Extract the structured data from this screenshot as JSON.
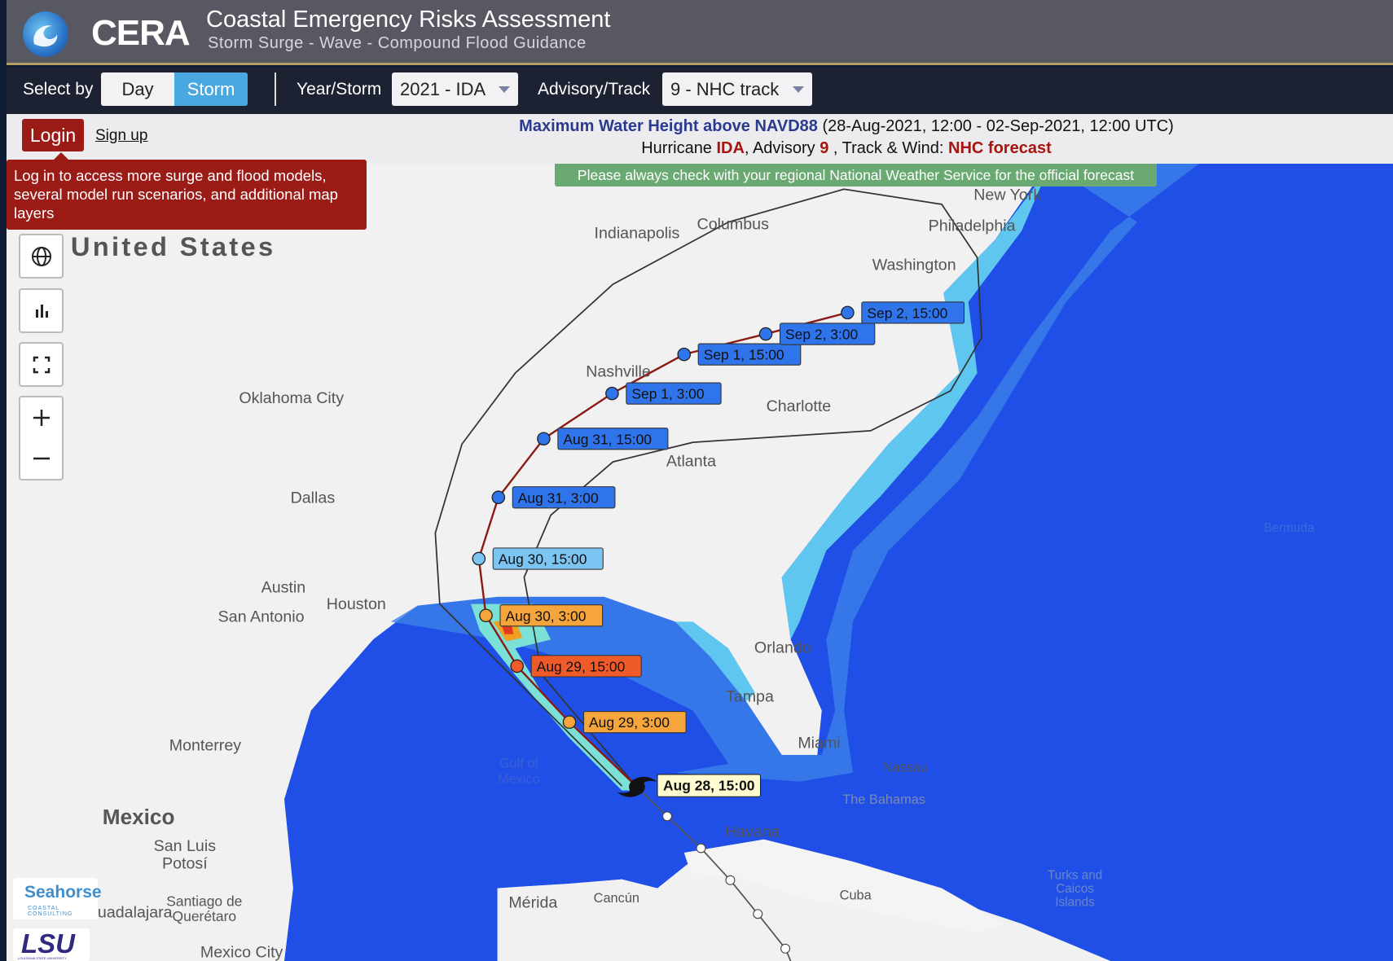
{
  "header": {
    "brand": "CERA",
    "title": "Coastal Emergency Risks Assessment",
    "subtitle": "Storm Surge - Wave - Compound Flood Guidance"
  },
  "toolbar": {
    "select_by_label": "Select by",
    "day": "Day",
    "storm": "Storm",
    "active": "Storm",
    "year_storm_label": "Year/Storm",
    "year_storm_value": "2021 - IDA",
    "advisory_label": "Advisory/Track",
    "advisory_value": "9 - NHC track"
  },
  "auth": {
    "login": "Login",
    "signup": "Sign up",
    "tooltip": "Log in to access more surge and flood models, several model run scenarios, and additional map layers"
  },
  "info": {
    "product": "Maximum Water Height above NAVD88",
    "period": " (28-Aug-2021, 12:00 - 02-Sep-2021, 12:00 UTC)",
    "hurricane_label": "Hurricane ",
    "storm": "IDA",
    "advisory_label": ", Advisory ",
    "advisory": "9",
    "track_label": " , Track & Wind: ",
    "track": "NHC forecast"
  },
  "notice": "Please always check with your regional National Weather Service for the official forecast",
  "track": {
    "current": "Aug 28, 15:00",
    "points": [
      {
        "label": "Aug 29, 3:00",
        "color": "#f6a53c"
      },
      {
        "label": "Aug 29, 15:00",
        "color": "#ef5a2b"
      },
      {
        "label": "Aug 30, 3:00",
        "color": "#f6a53c"
      },
      {
        "label": "Aug 30, 15:00",
        "color": "#7cc4f2"
      },
      {
        "label": "Aug 31, 3:00",
        "color": "#2f74ea"
      },
      {
        "label": "Aug 31, 15:00",
        "color": "#2f74ea"
      },
      {
        "label": "Sep 1, 3:00",
        "color": "#2f74ea"
      },
      {
        "label": "Sep 1, 15:00",
        "color": "#2f74ea"
      },
      {
        "label": "Sep 2, 3:00",
        "color": "#2f74ea"
      },
      {
        "label": "Sep 2, 15:00",
        "color": "#2f74ea"
      }
    ],
    "track_color": "#8b1a14"
  },
  "map_labels": {
    "us": "United States",
    "indianapolis": "Indianapolis",
    "columbus": "Columbus",
    "new_york": "New York",
    "philadelphia": "Philadelphia",
    "washington": "Washington",
    "nashville": "Nashville",
    "charlotte": "Charlotte",
    "oklahoma_city": "Oklahoma City",
    "atlanta": "Atlanta",
    "dallas": "Dallas",
    "austin": "Austin",
    "san_antonio": "San Antonio",
    "houston": "Houston",
    "orlando": "Orlando",
    "tampa": "Tampa",
    "miami": "Miami",
    "nassau": "Nassau",
    "the_bahamas": "The Bahamas",
    "monterrey": "Monterrey",
    "mexico": "Mexico",
    "san_luis": "San Luis",
    "potosi": "Potosí",
    "havana": "Havana",
    "merida": "Mérida",
    "cancun": "Cancún",
    "cuba": "Cuba",
    "santiago": "Santiago de",
    "queretaro": "Querétaro",
    "guadalajara": "Guadalajara",
    "mexico_city": "Mexico City",
    "bermuda": "Bermuda",
    "gulf1": "Gulf of",
    "gulf2": "Mexico",
    "turks1": "Turks and",
    "turks2": "Caicos",
    "turks3": "Islands"
  },
  "logos": {
    "seahorse": "Seahorse",
    "seahorse_sub": "COASTAL CONSULTING",
    "lsu": "LSU",
    "lsu_sub": "LOUISIANA STATE UNIVERSITY"
  },
  "colors": {
    "header": "#575862",
    "toolbar": "#1c2232",
    "accent": "#4aa8e0",
    "login": "#9b1b17",
    "notice": "#6aaa72"
  }
}
